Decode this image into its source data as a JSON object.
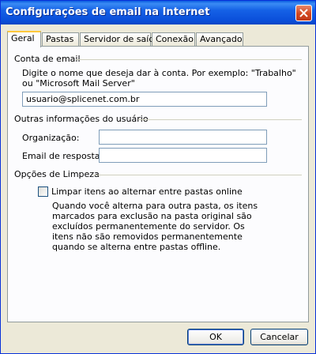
{
  "window": {
    "title": "Configurações de email na Internet"
  },
  "tabs": [
    {
      "label": "Geral"
    },
    {
      "label": "Pastas"
    },
    {
      "label": "Servidor de saída"
    },
    {
      "label": "Conexão"
    },
    {
      "label": "Avançado"
    }
  ],
  "account": {
    "group_label": "Conta de email",
    "description": "Digite o nome que deseja dar à conta. Por exemplo: \"Trabalho\" ou \"Microsoft Mail Server\"",
    "name_value": "usuario@splicenet.com.br"
  },
  "user_info": {
    "group_label": "Outras informações do usuário",
    "organization_label": "Organização:",
    "organization_value": "",
    "reply_label": "Email de resposta:",
    "reply_value": ""
  },
  "cleanup": {
    "group_label": "Opções de Limpeza",
    "checkbox_label": "Limpar itens ao alternar entre pastas online",
    "checkbox_checked": false,
    "help_text": "Quando você alterna para outra pasta, os itens marcados para exclusão na pasta original são excluídos permanentemente do servidor. Os itens não são removidos permanentemente quando se alterna entre pastas offline."
  },
  "buttons": {
    "ok": "OK",
    "cancel": "Cancelar"
  }
}
